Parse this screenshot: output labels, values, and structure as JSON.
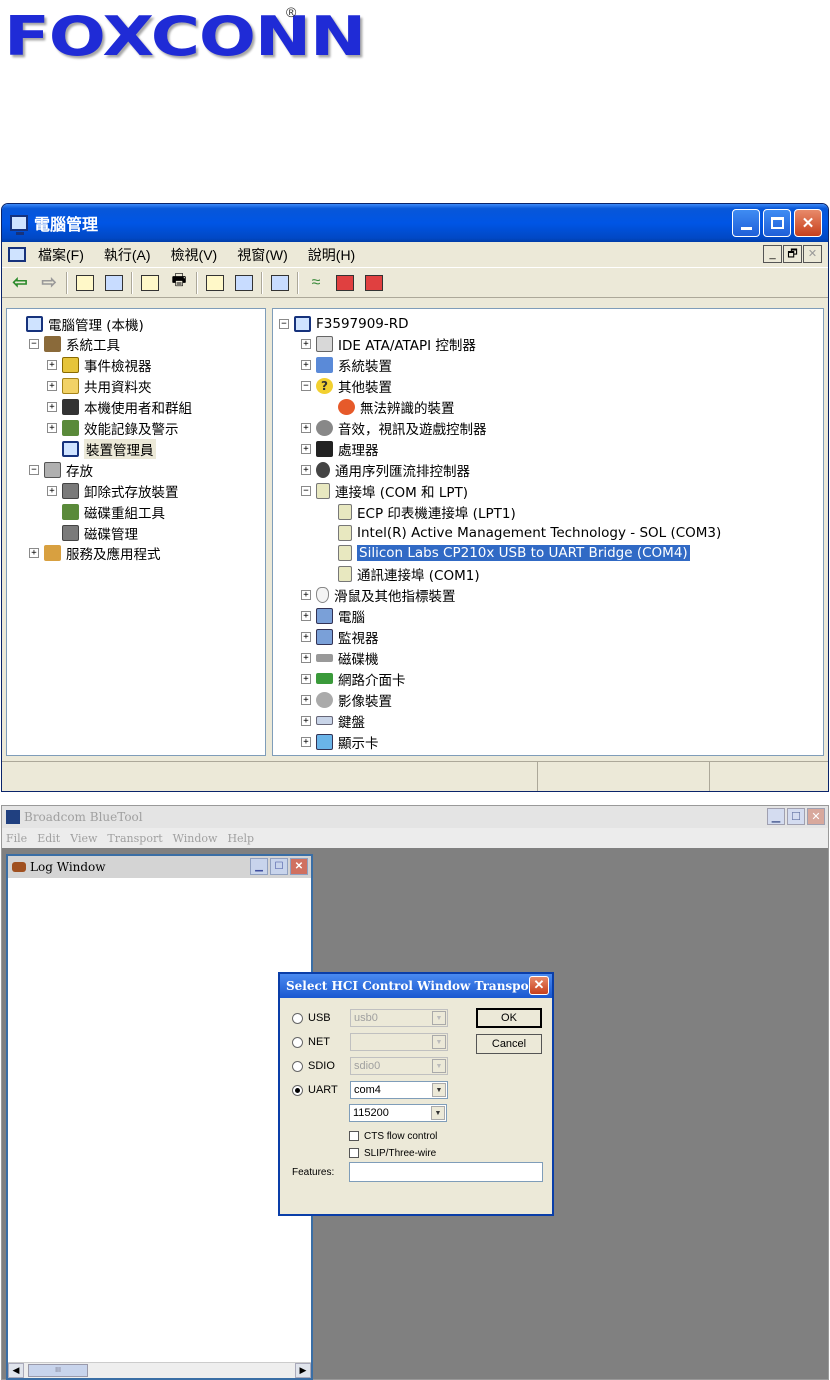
{
  "logo": {
    "text": "FOXCONN",
    "registered": "®"
  },
  "computer_management": {
    "title": "電腦管理",
    "menu": [
      "檔案(F)",
      "執行(A)",
      "檢視(V)",
      "視窗(W)",
      "說明(H)"
    ],
    "mdi_buttons": [
      "_",
      "🗗",
      "✕"
    ],
    "left_tree": [
      {
        "label": "電腦管理 (本機)",
        "level": 0,
        "icon": "computer-icon",
        "expander": ""
      },
      {
        "label": "系統工具",
        "level": 1,
        "icon": "tools-icon",
        "expander": "−"
      },
      {
        "label": "事件檢視器",
        "level": 2,
        "icon": "event-viewer-icon",
        "expander": "+"
      },
      {
        "label": "共用資料夾",
        "level": 2,
        "icon": "shared-folder-icon",
        "expander": "+"
      },
      {
        "label": "本機使用者和群組",
        "level": 2,
        "icon": "users-icon",
        "expander": "+"
      },
      {
        "label": "效能記錄及警示",
        "level": 2,
        "icon": "performance-icon",
        "expander": "+"
      },
      {
        "label": "裝置管理員",
        "level": 2,
        "icon": "device-manager-icon",
        "expander": "",
        "active": true
      },
      {
        "label": "存放",
        "level": 1,
        "icon": "storage-icon",
        "expander": "−"
      },
      {
        "label": "卸除式存放裝置",
        "level": 2,
        "icon": "removable-storage-icon",
        "expander": "+"
      },
      {
        "label": "磁碟重組工具",
        "level": 2,
        "icon": "defrag-icon",
        "expander": ""
      },
      {
        "label": "磁碟管理",
        "level": 2,
        "icon": "disk-management-icon",
        "expander": ""
      },
      {
        "label": "服務及應用程式",
        "level": 1,
        "icon": "services-icon",
        "expander": "+"
      }
    ],
    "device_tree": [
      {
        "label": "F3597909-RD",
        "level": 0,
        "icon": "computer-icon",
        "expander": "−"
      },
      {
        "label": "IDE ATA/ATAPI 控制器",
        "level": 1,
        "icon": "ide-controller-icon",
        "expander": "+"
      },
      {
        "label": "系統裝置",
        "level": 1,
        "icon": "system-device-icon",
        "expander": "+"
      },
      {
        "label": "其他裝置",
        "level": 1,
        "icon": "question-icon",
        "expander": "−"
      },
      {
        "label": "無法辨識的裝置",
        "level": 2,
        "icon": "unknown-device-icon",
        "expander": ""
      },
      {
        "label": "音效，視訊及遊戲控制器",
        "level": 1,
        "icon": "sound-icon",
        "expander": "+"
      },
      {
        "label": "處理器",
        "level": 1,
        "icon": "processor-icon",
        "expander": "+"
      },
      {
        "label": "通用序列匯流排控制器",
        "level": 1,
        "icon": "usb-icon",
        "expander": "+"
      },
      {
        "label": "連接埠 (COM 和 LPT)",
        "level": 1,
        "icon": "port-icon",
        "expander": "−"
      },
      {
        "label": "ECP 印表機連接埠 (LPT1)",
        "level": 2,
        "icon": "port-icon",
        "expander": ""
      },
      {
        "label": "Intel(R) Active Management Technology - SOL (COM3)",
        "level": 2,
        "icon": "port-icon",
        "expander": ""
      },
      {
        "label": "Silicon Labs CP210x USB to UART Bridge (COM4)",
        "level": 2,
        "icon": "port-icon",
        "expander": "",
        "selected": true
      },
      {
        "label": "通訊連接埠 (COM1)",
        "level": 2,
        "icon": "port-icon",
        "expander": ""
      },
      {
        "label": "滑鼠及其他指標裝置",
        "level": 1,
        "icon": "mouse-icon",
        "expander": "+"
      },
      {
        "label": "電腦",
        "level": 1,
        "icon": "computer-device-icon",
        "expander": "+"
      },
      {
        "label": "監視器",
        "level": 1,
        "icon": "monitor-icon",
        "expander": "+"
      },
      {
        "label": "磁碟機",
        "level": 1,
        "icon": "disk-drive-icon",
        "expander": "+"
      },
      {
        "label": "網路介面卡",
        "level": 1,
        "icon": "network-adapter-icon",
        "expander": "+"
      },
      {
        "label": "影像裝置",
        "level": 1,
        "icon": "imaging-device-icon",
        "expander": "+"
      },
      {
        "label": "鍵盤",
        "level": 1,
        "icon": "keyboard-icon",
        "expander": "+"
      },
      {
        "label": "顯示卡",
        "level": 1,
        "icon": "display-adapter-icon",
        "expander": "+"
      }
    ]
  },
  "bluetool": {
    "title": "Broadcom BlueTool",
    "menu": [
      "File",
      "Edit",
      "View",
      "Transport",
      "Window",
      "Help"
    ],
    "log_window": {
      "title": "Log Window",
      "scroll_thumb": "III"
    },
    "dialog": {
      "title": "Select HCI Control Window Transport",
      "options": [
        {
          "label": "USB",
          "value": "usb0",
          "enabled": false,
          "checked": false
        },
        {
          "label": "NET",
          "value": "",
          "enabled": false,
          "checked": false
        },
        {
          "label": "SDIO",
          "value": "sdio0",
          "enabled": false,
          "checked": false
        },
        {
          "label": "UART",
          "value": "com4",
          "enabled": true,
          "checked": true
        }
      ],
      "baud": "115200",
      "checkboxes": [
        "CTS flow control",
        "SLIP/Three-wire"
      ],
      "features_label": "Features:",
      "ok_label": "OK",
      "cancel_label": "Cancel"
    }
  }
}
